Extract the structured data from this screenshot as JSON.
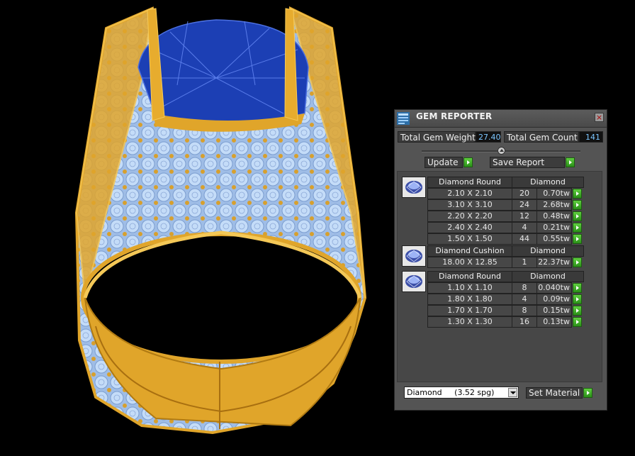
{
  "panel": {
    "title": "GEM REPORTER",
    "close_glyph": "×",
    "total_gem_weight_label": "Total Gem Weight",
    "total_gem_weight_value": "27.40",
    "total_gem_count_label": "Total Gem Count",
    "total_gem_count_value": "141",
    "update_label": "Update",
    "save_report_label": "Save Report",
    "groups": [
      {
        "icon": "diamond-round-icon",
        "shape": "Diamond Round",
        "material": "Diamond",
        "rows": [
          {
            "size": "2.10 X 2.10",
            "count": "20",
            "tw": "0.70tw"
          },
          {
            "size": "3.10 X 3.10",
            "count": "24",
            "tw": "2.68tw"
          },
          {
            "size": "2.20 X 2.20",
            "count": "12",
            "tw": "0.48tw"
          },
          {
            "size": "2.40 X 2.40",
            "count": "4",
            "tw": "0.21tw"
          },
          {
            "size": "1.50 X 1.50",
            "count": "44",
            "tw": "0.55tw"
          }
        ]
      },
      {
        "icon": "diamond-cushion-icon",
        "shape": "Diamond Cushion",
        "material": "Diamond",
        "rows": [
          {
            "size": "18.00 X 12.85",
            "count": "1",
            "tw": "22.37tw"
          }
        ]
      },
      {
        "icon": "diamond-round-icon",
        "shape": "Diamond Round",
        "material": "Diamond",
        "rows": [
          {
            "size": "1.10 X 1.10",
            "count": "8",
            "tw": "0.040tw"
          },
          {
            "size": "1.80 X 1.80",
            "count": "4",
            "tw": "0.09tw"
          },
          {
            "size": "1.70 X 1.70",
            "count": "8",
            "tw": "0.15tw"
          },
          {
            "size": "1.30 X 1.30",
            "count": "16",
            "tw": "0.13tw"
          }
        ]
      }
    ],
    "material_select_value": "Diamond     (3.52 spg)",
    "set_material_label": "Set Material"
  },
  "colors": {
    "gold": "#e0a52a",
    "gem_blue": "#1a3fb0",
    "pave_light": "#b8d4f5",
    "go_green": "#3aa623",
    "value_text": "#7cc6ff"
  }
}
